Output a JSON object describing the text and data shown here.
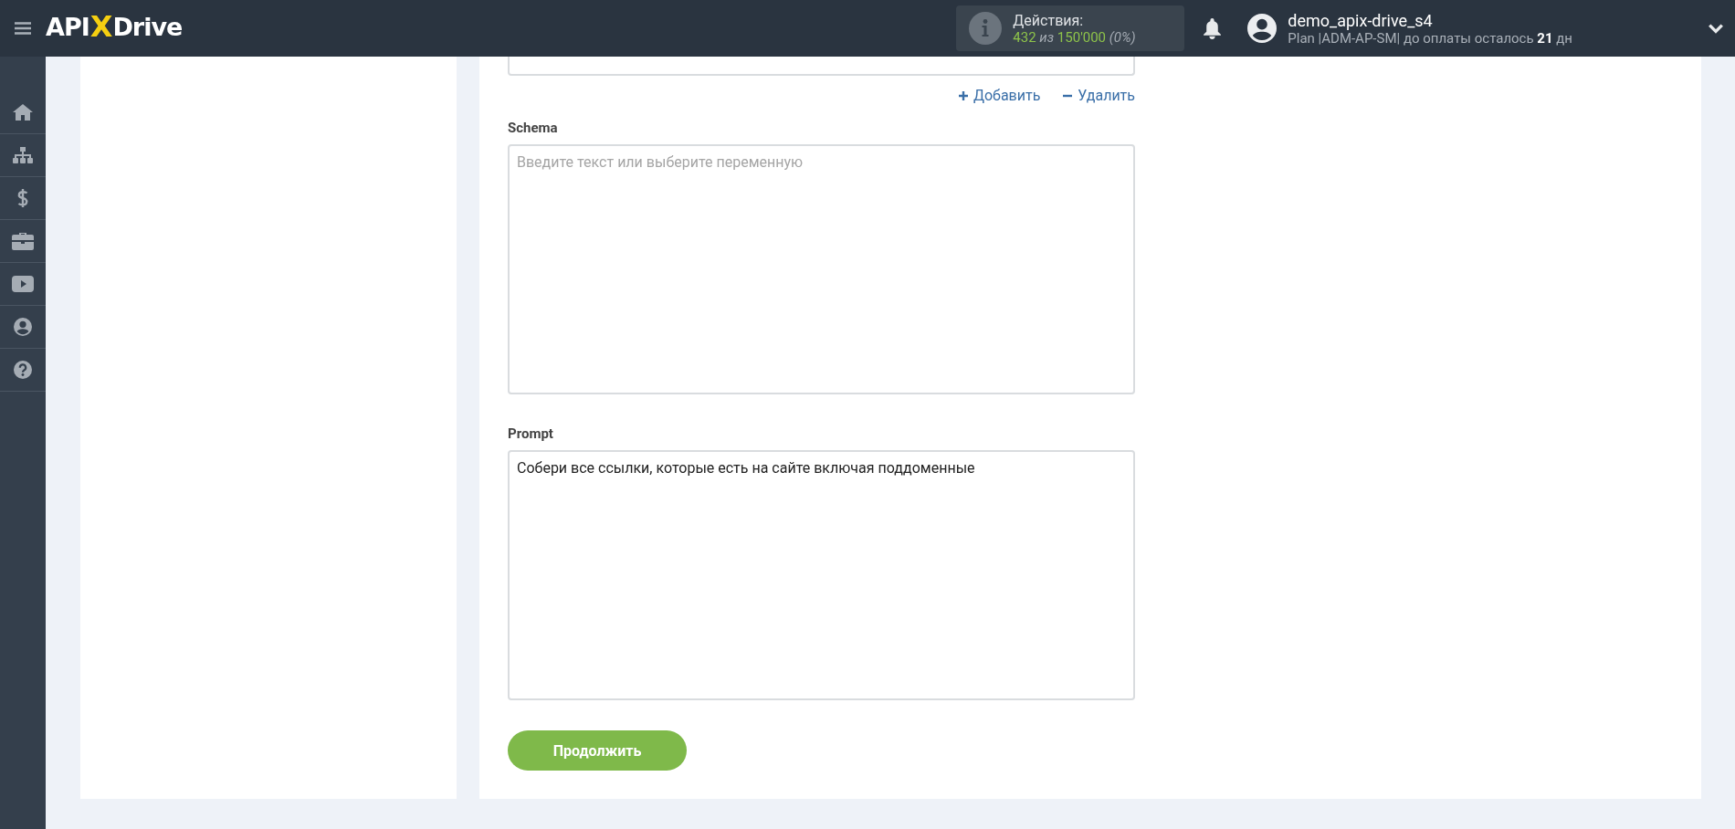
{
  "header": {
    "logo": {
      "left": "API",
      "mark": "X",
      "right": "Drive"
    },
    "actions": {
      "label": "Действия:",
      "used": "432",
      "sep": "из",
      "total": "150'000",
      "percent": "(0%)"
    },
    "user": {
      "name": "demo_apix-drive_s4",
      "plan": "Plan |ADM-AP-SM| до оплаты осталось **21** дн"
    }
  },
  "sidebar": {
    "items": [
      {
        "selected": false
      },
      {
        "selected": false
      },
      {
        "selected": false
      },
      {
        "selected": false
      },
      {
        "selected": false
      },
      {
        "selected": false
      },
      {
        "selected": false
      }
    ]
  },
  "form": {
    "add_link": "Добавить",
    "remove_link": "Удалить",
    "fields": [
      {
        "label": "Schema",
        "placeholder": "Введите текст или выберите переменную"
      },
      {
        "label": "Prompt",
        "value": "Собери все ссылки, которые есть на сайте включая поддоменные"
      }
    ],
    "continue_button": "Продолжить"
  }
}
